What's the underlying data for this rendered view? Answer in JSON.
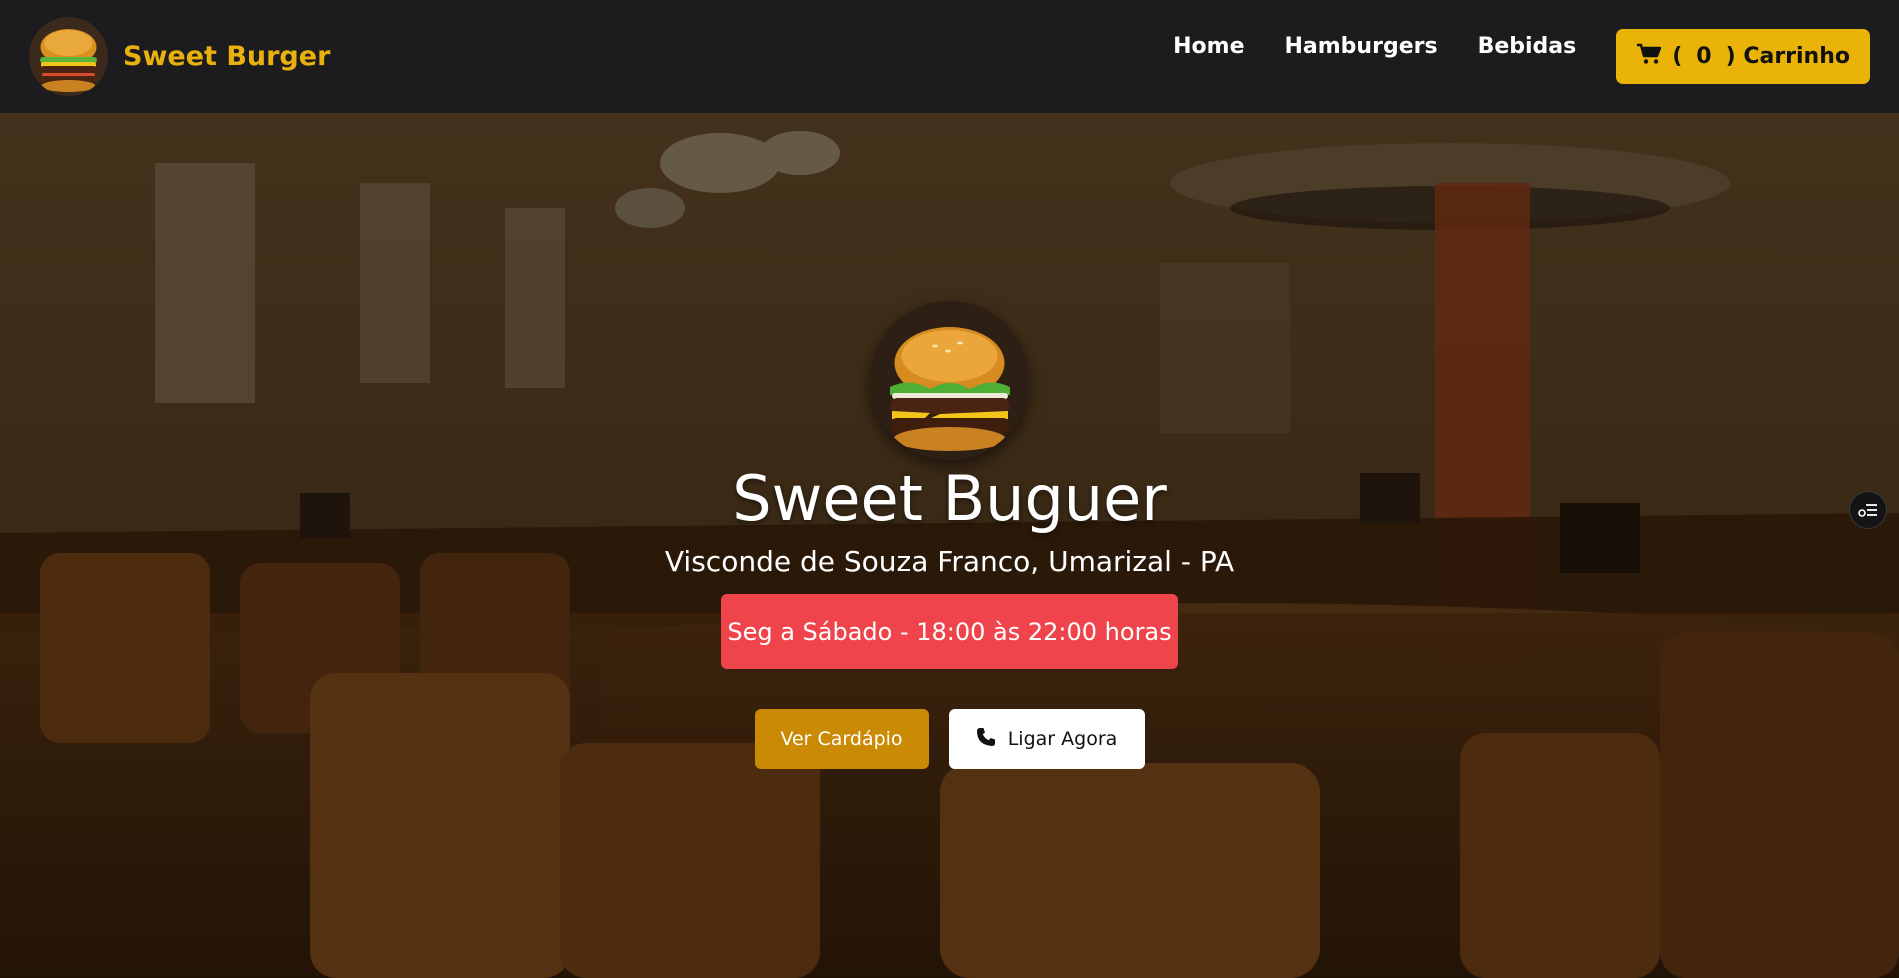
{
  "brand": {
    "name": "Sweet Burger",
    "logo_icon": "burger-logo"
  },
  "nav": {
    "links": [
      "Home",
      "Hamburgers",
      "Bebidas"
    ],
    "cart": {
      "open_paren": "(",
      "count": "0",
      "close_label": ") Carrinho",
      "icon": "cart-icon"
    }
  },
  "hero": {
    "title": "Sweet Buguer",
    "address": "Visconde de Souza Franco, Umarizal - PA",
    "hours": "Seg a Sábado - 18:00 às 22:00 horas",
    "menu_button": "Ver Cardápio",
    "call_button": "Ligar Agora",
    "call_icon": "phone-icon"
  },
  "colors": {
    "accent": "#eab308",
    "menu_button": "#ca8a04",
    "hours_badge": "#ef444b",
    "navbar": "#1c1c1f"
  },
  "widget": {
    "icon": "settings-list-icon"
  }
}
